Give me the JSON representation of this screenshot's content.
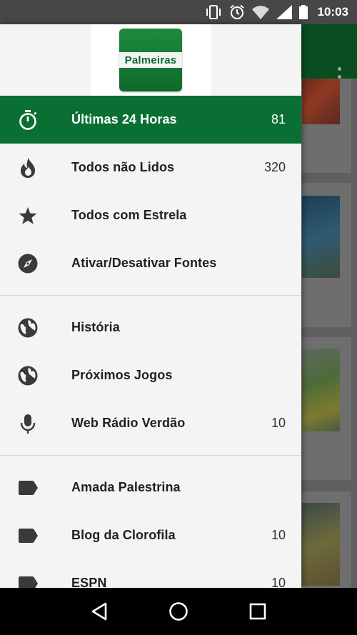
{
  "status_bar": {
    "time": "10:03",
    "icons": [
      "vibrate-icon",
      "alarm-icon",
      "wifi-icon",
      "signal-icon",
      "battery-icon"
    ]
  },
  "app": {
    "logo_text": "Palmeiras",
    "accent_color": "#0a6f33"
  },
  "drawer": {
    "groups": [
      [
        {
          "icon": "timer-icon",
          "label": "Últimas 24 Horas",
          "count": "81",
          "active": true
        },
        {
          "icon": "fire-icon",
          "label": "Todos não Lidos",
          "count": "320"
        },
        {
          "icon": "star-icon",
          "label": "Todos com Estrela",
          "count": ""
        },
        {
          "icon": "compass-icon",
          "label": "Ativar/Desativar Fontes",
          "count": ""
        }
      ],
      [
        {
          "icon": "globe-icon",
          "label": "História",
          "count": ""
        },
        {
          "icon": "globe-icon",
          "label": "Próximos Jogos",
          "count": ""
        },
        {
          "icon": "microphone-icon",
          "label": "Web Rádio Verdão",
          "count": "10"
        }
      ],
      [
        {
          "icon": "label-icon",
          "label": "Amada Palestrina",
          "count": ""
        },
        {
          "icon": "label-icon",
          "label": "Blog da Clorofila",
          "count": "10"
        },
        {
          "icon": "label-icon",
          "label": "ESPN",
          "count": "10"
        }
      ]
    ]
  },
  "nav_bar": {
    "icons": [
      "back-icon",
      "home-icon",
      "recents-icon"
    ]
  }
}
